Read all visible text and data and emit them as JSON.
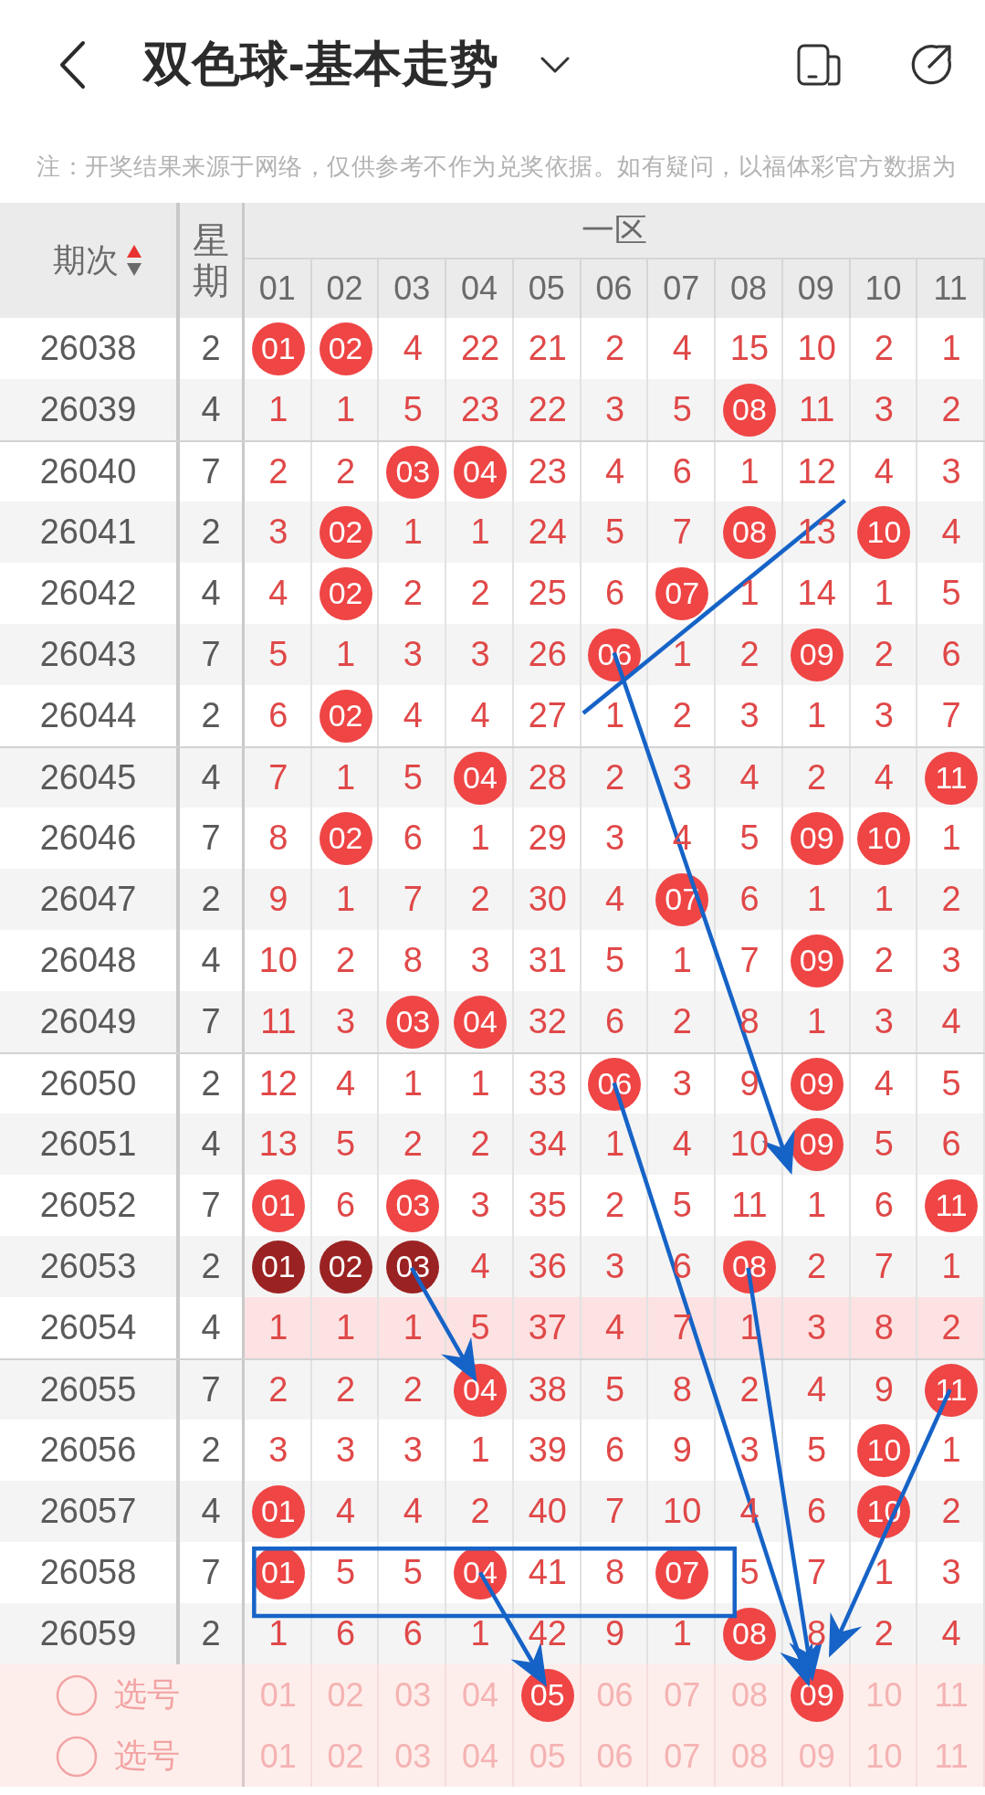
{
  "header": {
    "title": "双色球-基本走势"
  },
  "notice": "注：开奖结果来源于网络，仅供参考不作为兑奖依据。如有疑问，以福体彩官方数据为",
  "table": {
    "columns": {
      "period": "期次",
      "weekday": "星期",
      "zone": "一区",
      "numbers": [
        "01",
        "02",
        "03",
        "04",
        "05",
        "06",
        "07",
        "08",
        "09",
        "10",
        "11"
      ]
    },
    "sort_ascending": true,
    "rows": [
      {
        "period": "26038",
        "weekday": "2",
        "highlighted": false,
        "cells": [
          {
            "kind": "ball",
            "text": "01"
          },
          {
            "kind": "ball",
            "text": "02"
          },
          {
            "kind": "count",
            "text": "4"
          },
          {
            "kind": "count",
            "text": "22"
          },
          {
            "kind": "count",
            "text": "21"
          },
          {
            "kind": "count",
            "text": "2"
          },
          {
            "kind": "count",
            "text": "4"
          },
          {
            "kind": "count",
            "text": "15"
          },
          {
            "kind": "count",
            "text": "10"
          },
          {
            "kind": "count",
            "text": "2"
          },
          {
            "kind": "count",
            "text": "1"
          }
        ]
      },
      {
        "period": "26039",
        "weekday": "4",
        "highlighted": false,
        "cells": [
          {
            "kind": "count",
            "text": "1"
          },
          {
            "kind": "count",
            "text": "1"
          },
          {
            "kind": "count",
            "text": "5"
          },
          {
            "kind": "count",
            "text": "23"
          },
          {
            "kind": "count",
            "text": "22"
          },
          {
            "kind": "count",
            "text": "3"
          },
          {
            "kind": "count",
            "text": "5"
          },
          {
            "kind": "ball",
            "text": "08"
          },
          {
            "kind": "count",
            "text": "11"
          },
          {
            "kind": "count",
            "text": "3"
          },
          {
            "kind": "count",
            "text": "2"
          }
        ]
      },
      {
        "period": "26040",
        "weekday": "7",
        "highlighted": false,
        "cells": [
          {
            "kind": "count",
            "text": "2"
          },
          {
            "kind": "count",
            "text": "2"
          },
          {
            "kind": "ball",
            "text": "03"
          },
          {
            "kind": "ball",
            "text": "04"
          },
          {
            "kind": "count",
            "text": "23"
          },
          {
            "kind": "count",
            "text": "4"
          },
          {
            "kind": "count",
            "text": "6"
          },
          {
            "kind": "count",
            "text": "1"
          },
          {
            "kind": "count",
            "text": "12"
          },
          {
            "kind": "count",
            "text": "4"
          },
          {
            "kind": "count",
            "text": "3"
          }
        ]
      },
      {
        "period": "26041",
        "weekday": "2",
        "highlighted": false,
        "cells": [
          {
            "kind": "count",
            "text": "3"
          },
          {
            "kind": "ball",
            "text": "02"
          },
          {
            "kind": "count",
            "text": "1"
          },
          {
            "kind": "count",
            "text": "1"
          },
          {
            "kind": "count",
            "text": "24"
          },
          {
            "kind": "count",
            "text": "5"
          },
          {
            "kind": "count",
            "text": "7"
          },
          {
            "kind": "ball",
            "text": "08"
          },
          {
            "kind": "count",
            "text": "13"
          },
          {
            "kind": "ball",
            "text": "10"
          },
          {
            "kind": "count",
            "text": "4"
          }
        ]
      },
      {
        "period": "26042",
        "weekday": "4",
        "highlighted": false,
        "cells": [
          {
            "kind": "count",
            "text": "4"
          },
          {
            "kind": "ball",
            "text": "02"
          },
          {
            "kind": "count",
            "text": "2"
          },
          {
            "kind": "count",
            "text": "2"
          },
          {
            "kind": "count",
            "text": "25"
          },
          {
            "kind": "count",
            "text": "6"
          },
          {
            "kind": "ball",
            "text": "07"
          },
          {
            "kind": "count",
            "text": "1"
          },
          {
            "kind": "count",
            "text": "14"
          },
          {
            "kind": "count",
            "text": "1"
          },
          {
            "kind": "count",
            "text": "5"
          }
        ]
      },
      {
        "period": "26043",
        "weekday": "7",
        "highlighted": false,
        "cells": [
          {
            "kind": "count",
            "text": "5"
          },
          {
            "kind": "count",
            "text": "1"
          },
          {
            "kind": "count",
            "text": "3"
          },
          {
            "kind": "count",
            "text": "3"
          },
          {
            "kind": "count",
            "text": "26"
          },
          {
            "kind": "ball",
            "text": "06"
          },
          {
            "kind": "count",
            "text": "1"
          },
          {
            "kind": "count",
            "text": "2"
          },
          {
            "kind": "ball",
            "text": "09"
          },
          {
            "kind": "count",
            "text": "2"
          },
          {
            "kind": "count",
            "text": "6"
          }
        ]
      },
      {
        "period": "26044",
        "weekday": "2",
        "highlighted": false,
        "cells": [
          {
            "kind": "count",
            "text": "6"
          },
          {
            "kind": "ball",
            "text": "02"
          },
          {
            "kind": "count",
            "text": "4"
          },
          {
            "kind": "count",
            "text": "4"
          },
          {
            "kind": "count",
            "text": "27"
          },
          {
            "kind": "count",
            "text": "1"
          },
          {
            "kind": "count",
            "text": "2"
          },
          {
            "kind": "count",
            "text": "3"
          },
          {
            "kind": "count",
            "text": "1"
          },
          {
            "kind": "count",
            "text": "3"
          },
          {
            "kind": "count",
            "text": "7"
          }
        ]
      },
      {
        "period": "26045",
        "weekday": "4",
        "highlighted": false,
        "cells": [
          {
            "kind": "count",
            "text": "7"
          },
          {
            "kind": "count",
            "text": "1"
          },
          {
            "kind": "count",
            "text": "5"
          },
          {
            "kind": "ball",
            "text": "04"
          },
          {
            "kind": "count",
            "text": "28"
          },
          {
            "kind": "count",
            "text": "2"
          },
          {
            "kind": "count",
            "text": "3"
          },
          {
            "kind": "count",
            "text": "4"
          },
          {
            "kind": "count",
            "text": "2"
          },
          {
            "kind": "count",
            "text": "4"
          },
          {
            "kind": "ball",
            "text": "11"
          }
        ]
      },
      {
        "period": "26046",
        "weekday": "7",
        "highlighted": false,
        "cells": [
          {
            "kind": "count",
            "text": "8"
          },
          {
            "kind": "ball",
            "text": "02"
          },
          {
            "kind": "count",
            "text": "6"
          },
          {
            "kind": "count",
            "text": "1"
          },
          {
            "kind": "count",
            "text": "29"
          },
          {
            "kind": "count",
            "text": "3"
          },
          {
            "kind": "count",
            "text": "4"
          },
          {
            "kind": "count",
            "text": "5"
          },
          {
            "kind": "ball",
            "text": "09"
          },
          {
            "kind": "ball",
            "text": "10"
          },
          {
            "kind": "count",
            "text": "1"
          }
        ]
      },
      {
        "period": "26047",
        "weekday": "2",
        "highlighted": false,
        "cells": [
          {
            "kind": "count",
            "text": "9"
          },
          {
            "kind": "count",
            "text": "1"
          },
          {
            "kind": "count",
            "text": "7"
          },
          {
            "kind": "count",
            "text": "2"
          },
          {
            "kind": "count",
            "text": "30"
          },
          {
            "kind": "count",
            "text": "4"
          },
          {
            "kind": "ball",
            "text": "07"
          },
          {
            "kind": "count",
            "text": "6"
          },
          {
            "kind": "count",
            "text": "1"
          },
          {
            "kind": "count",
            "text": "1"
          },
          {
            "kind": "count",
            "text": "2"
          }
        ]
      },
      {
        "period": "26048",
        "weekday": "4",
        "highlighted": false,
        "cells": [
          {
            "kind": "count",
            "text": "10"
          },
          {
            "kind": "count",
            "text": "2"
          },
          {
            "kind": "count",
            "text": "8"
          },
          {
            "kind": "count",
            "text": "3"
          },
          {
            "kind": "count",
            "text": "31"
          },
          {
            "kind": "count",
            "text": "5"
          },
          {
            "kind": "count",
            "text": "1"
          },
          {
            "kind": "count",
            "text": "7"
          },
          {
            "kind": "ball",
            "text": "09"
          },
          {
            "kind": "count",
            "text": "2"
          },
          {
            "kind": "count",
            "text": "3"
          }
        ]
      },
      {
        "period": "26049",
        "weekday": "7",
        "highlighted": false,
        "cells": [
          {
            "kind": "count",
            "text": "11"
          },
          {
            "kind": "count",
            "text": "3"
          },
          {
            "kind": "ball",
            "text": "03"
          },
          {
            "kind": "ball",
            "text": "04"
          },
          {
            "kind": "count",
            "text": "32"
          },
          {
            "kind": "count",
            "text": "6"
          },
          {
            "kind": "count",
            "text": "2"
          },
          {
            "kind": "count",
            "text": "8"
          },
          {
            "kind": "count",
            "text": "1"
          },
          {
            "kind": "count",
            "text": "3"
          },
          {
            "kind": "count",
            "text": "4"
          }
        ]
      },
      {
        "period": "26050",
        "weekday": "2",
        "highlighted": false,
        "cells": [
          {
            "kind": "count",
            "text": "12"
          },
          {
            "kind": "count",
            "text": "4"
          },
          {
            "kind": "count",
            "text": "1"
          },
          {
            "kind": "count",
            "text": "1"
          },
          {
            "kind": "count",
            "text": "33"
          },
          {
            "kind": "ball",
            "text": "06"
          },
          {
            "kind": "count",
            "text": "3"
          },
          {
            "kind": "count",
            "text": "9"
          },
          {
            "kind": "ball",
            "text": "09"
          },
          {
            "kind": "count",
            "text": "4"
          },
          {
            "kind": "count",
            "text": "5"
          }
        ]
      },
      {
        "period": "26051",
        "weekday": "4",
        "highlighted": false,
        "cells": [
          {
            "kind": "count",
            "text": "13"
          },
          {
            "kind": "count",
            "text": "5"
          },
          {
            "kind": "count",
            "text": "2"
          },
          {
            "kind": "count",
            "text": "2"
          },
          {
            "kind": "count",
            "text": "34"
          },
          {
            "kind": "count",
            "text": "1"
          },
          {
            "kind": "count",
            "text": "4"
          },
          {
            "kind": "count",
            "text": "10"
          },
          {
            "kind": "ball",
            "text": "09"
          },
          {
            "kind": "count",
            "text": "5"
          },
          {
            "kind": "count",
            "text": "6"
          }
        ]
      },
      {
        "period": "26052",
        "weekday": "7",
        "highlighted": false,
        "cells": [
          {
            "kind": "ball",
            "text": "01"
          },
          {
            "kind": "count",
            "text": "6"
          },
          {
            "kind": "ball",
            "text": "03"
          },
          {
            "kind": "count",
            "text": "3"
          },
          {
            "kind": "count",
            "text": "35"
          },
          {
            "kind": "count",
            "text": "2"
          },
          {
            "kind": "count",
            "text": "5"
          },
          {
            "kind": "count",
            "text": "11"
          },
          {
            "kind": "count",
            "text": "1"
          },
          {
            "kind": "count",
            "text": "6"
          },
          {
            "kind": "ball",
            "text": "11"
          }
        ]
      },
      {
        "period": "26053",
        "weekday": "2",
        "highlighted": false,
        "cells": [
          {
            "kind": "dark",
            "text": "01"
          },
          {
            "kind": "dark",
            "text": "02"
          },
          {
            "kind": "dark",
            "text": "03"
          },
          {
            "kind": "count",
            "text": "4"
          },
          {
            "kind": "count",
            "text": "36"
          },
          {
            "kind": "count",
            "text": "3"
          },
          {
            "kind": "count",
            "text": "6"
          },
          {
            "kind": "ball",
            "text": "08"
          },
          {
            "kind": "count",
            "text": "2"
          },
          {
            "kind": "count",
            "text": "7"
          },
          {
            "kind": "count",
            "text": "1"
          }
        ]
      },
      {
        "period": "26054",
        "weekday": "4",
        "highlighted": true,
        "cells": [
          {
            "kind": "count",
            "text": "1"
          },
          {
            "kind": "count",
            "text": "1"
          },
          {
            "kind": "count",
            "text": "1"
          },
          {
            "kind": "count",
            "text": "5"
          },
          {
            "kind": "count",
            "text": "37"
          },
          {
            "kind": "count",
            "text": "4"
          },
          {
            "kind": "count",
            "text": "7"
          },
          {
            "kind": "count",
            "text": "1"
          },
          {
            "kind": "count",
            "text": "3"
          },
          {
            "kind": "count",
            "text": "8"
          },
          {
            "kind": "count",
            "text": "2"
          }
        ]
      },
      {
        "period": "26055",
        "weekday": "7",
        "highlighted": false,
        "cells": [
          {
            "kind": "count",
            "text": "2"
          },
          {
            "kind": "count",
            "text": "2"
          },
          {
            "kind": "count",
            "text": "2"
          },
          {
            "kind": "ball",
            "text": "04"
          },
          {
            "kind": "count",
            "text": "38"
          },
          {
            "kind": "count",
            "text": "5"
          },
          {
            "kind": "count",
            "text": "8"
          },
          {
            "kind": "count",
            "text": "2"
          },
          {
            "kind": "count",
            "text": "4"
          },
          {
            "kind": "count",
            "text": "9"
          },
          {
            "kind": "ball",
            "text": "11"
          }
        ]
      },
      {
        "period": "26056",
        "weekday": "2",
        "highlighted": false,
        "cells": [
          {
            "kind": "count",
            "text": "3"
          },
          {
            "kind": "count",
            "text": "3"
          },
          {
            "kind": "count",
            "text": "3"
          },
          {
            "kind": "count",
            "text": "1"
          },
          {
            "kind": "count",
            "text": "39"
          },
          {
            "kind": "count",
            "text": "6"
          },
          {
            "kind": "count",
            "text": "9"
          },
          {
            "kind": "count",
            "text": "3"
          },
          {
            "kind": "count",
            "text": "5"
          },
          {
            "kind": "ball",
            "text": "10"
          },
          {
            "kind": "count",
            "text": "1"
          }
        ]
      },
      {
        "period": "26057",
        "weekday": "4",
        "highlighted": false,
        "cells": [
          {
            "kind": "ball",
            "text": "01"
          },
          {
            "kind": "count",
            "text": "4"
          },
          {
            "kind": "count",
            "text": "4"
          },
          {
            "kind": "count",
            "text": "2"
          },
          {
            "kind": "count",
            "text": "40"
          },
          {
            "kind": "count",
            "text": "7"
          },
          {
            "kind": "count",
            "text": "10"
          },
          {
            "kind": "count",
            "text": "4"
          },
          {
            "kind": "count",
            "text": "6"
          },
          {
            "kind": "ball",
            "text": "10"
          },
          {
            "kind": "count",
            "text": "2"
          }
        ]
      },
      {
        "period": "26058",
        "weekday": "7",
        "highlighted": false,
        "cells": [
          {
            "kind": "ball",
            "text": "01"
          },
          {
            "kind": "count",
            "text": "5"
          },
          {
            "kind": "count",
            "text": "5"
          },
          {
            "kind": "ball",
            "text": "04"
          },
          {
            "kind": "count",
            "text": "41"
          },
          {
            "kind": "count",
            "text": "8"
          },
          {
            "kind": "ball",
            "text": "07"
          },
          {
            "kind": "count",
            "text": "5"
          },
          {
            "kind": "count",
            "text": "7"
          },
          {
            "kind": "count",
            "text": "1"
          },
          {
            "kind": "count",
            "text": "3"
          }
        ]
      },
      {
        "period": "26059",
        "weekday": "2",
        "highlighted": false,
        "cells": [
          {
            "kind": "count",
            "text": "1"
          },
          {
            "kind": "count",
            "text": "6"
          },
          {
            "kind": "count",
            "text": "6"
          },
          {
            "kind": "count",
            "text": "1"
          },
          {
            "kind": "count",
            "text": "42"
          },
          {
            "kind": "count",
            "text": "9"
          },
          {
            "kind": "count",
            "text": "1"
          },
          {
            "kind": "ball",
            "text": "08"
          },
          {
            "kind": "count",
            "text": "8"
          },
          {
            "kind": "count",
            "text": "2"
          },
          {
            "kind": "count",
            "text": "4"
          }
        ]
      }
    ],
    "picks": [
      {
        "label": "选号",
        "checked": false,
        "numbers": [
          {
            "text": "01",
            "selected": false
          },
          {
            "text": "02",
            "selected": false
          },
          {
            "text": "03",
            "selected": false
          },
          {
            "text": "04",
            "selected": false
          },
          {
            "text": "05",
            "selected": true
          },
          {
            "text": "06",
            "selected": false
          },
          {
            "text": "07",
            "selected": false
          },
          {
            "text": "08",
            "selected": false
          },
          {
            "text": "09",
            "selected": true
          },
          {
            "text": "10",
            "selected": false
          },
          {
            "text": "11",
            "selected": false
          }
        ]
      },
      {
        "label": "选号",
        "checked": false,
        "numbers": [
          {
            "text": "01",
            "selected": false
          },
          {
            "text": "02",
            "selected": false
          },
          {
            "text": "03",
            "selected": false
          },
          {
            "text": "04",
            "selected": false
          },
          {
            "text": "05",
            "selected": false
          },
          {
            "text": "06",
            "selected": false
          },
          {
            "text": "07",
            "selected": false
          },
          {
            "text": "08",
            "selected": false
          },
          {
            "text": "09",
            "selected": false
          },
          {
            "text": "10",
            "selected": false
          },
          {
            "text": "11",
            "selected": false
          }
        ]
      }
    ]
  }
}
